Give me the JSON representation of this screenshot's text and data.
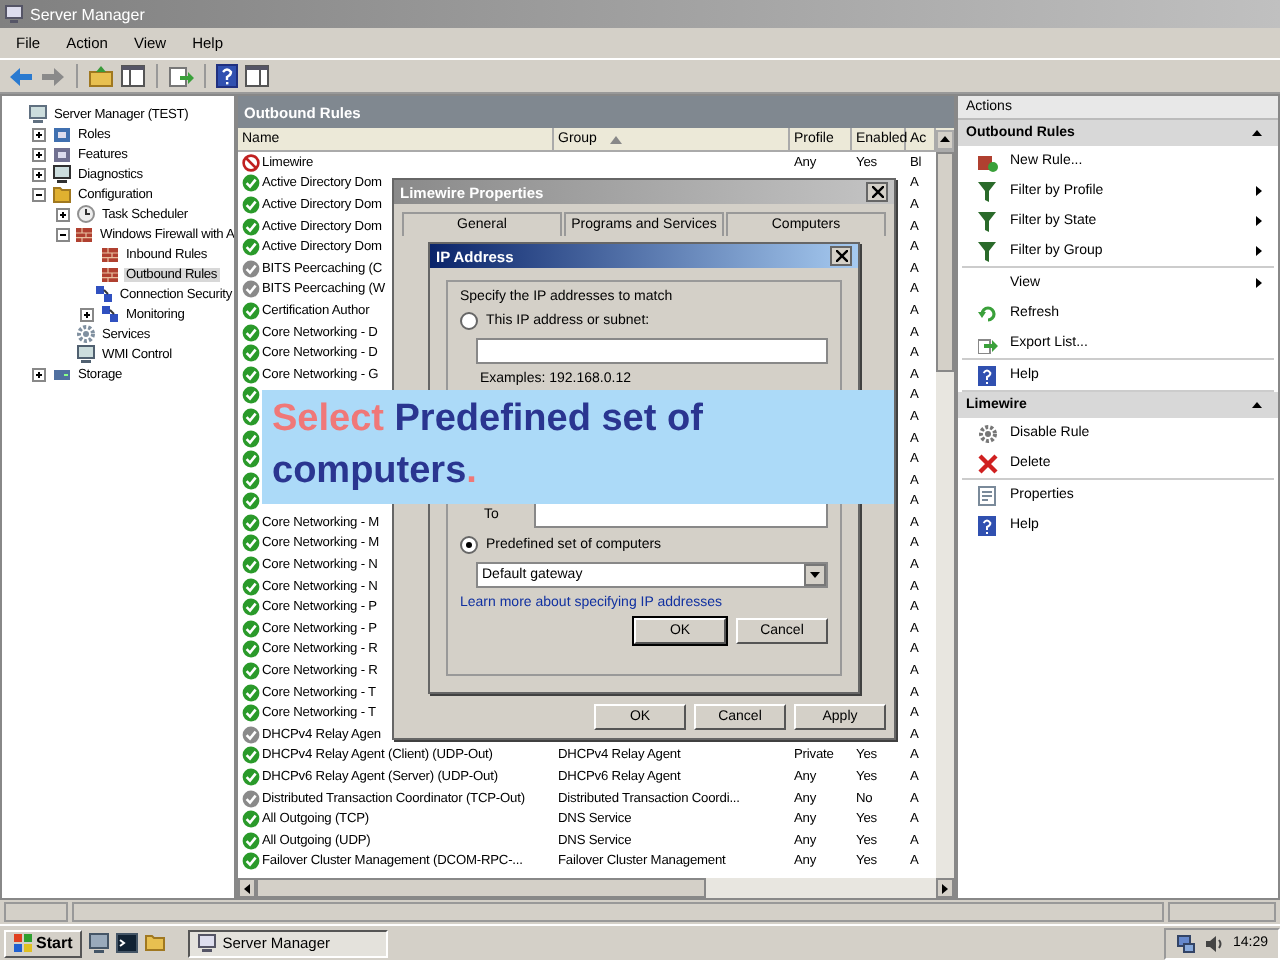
{
  "window": {
    "title": "Server Manager"
  },
  "menu": [
    "File",
    "Action",
    "View",
    "Help"
  ],
  "tree": [
    {
      "label": "Server Manager (TEST)",
      "kind": "server",
      "selected": false,
      "children": [
        {
          "label": "Roles",
          "kind": "roles",
          "selected": false,
          "expanded": false
        },
        {
          "label": "Features",
          "kind": "features",
          "selected": false,
          "expanded": false
        },
        {
          "label": "Diagnostics",
          "kind": "diagnostics",
          "selected": false,
          "expanded": false
        },
        {
          "label": "Configuration",
          "kind": "configuration",
          "selected": false,
          "expanded": true,
          "children": [
            {
              "label": "Task Scheduler",
              "kind": "scheduler",
              "selected": false,
              "expanded": false
            },
            {
              "label": "Windows Firewall with A",
              "kind": "firewall",
              "selected": false,
              "expanded": true,
              "children": [
                {
                  "label": "Inbound Rules",
                  "kind": "inbound",
                  "selected": false
                },
                {
                  "label": "Outbound Rules",
                  "kind": "outbound",
                  "selected": true
                },
                {
                  "label": "Connection Security",
                  "kind": "security",
                  "selected": false
                },
                {
                  "label": "Monitoring",
                  "kind": "monitoring",
                  "selected": false,
                  "expanded": false
                }
              ]
            },
            {
              "label": "Services",
              "kind": "services",
              "selected": false
            },
            {
              "label": "WMI Control",
              "kind": "wmi",
              "selected": false
            }
          ]
        },
        {
          "label": "Storage",
          "kind": "storage",
          "selected": false,
          "expanded": false
        }
      ]
    }
  ],
  "rules": {
    "title": "Outbound Rules",
    "columns": [
      "Name",
      "Group",
      "Profile",
      "Enabled",
      "Ac"
    ],
    "rows": [
      {
        "kind": "block",
        "name": "Limewire",
        "profile": "Any",
        "enabled": "Yes",
        "action": "Bl"
      },
      {
        "kind": "allow",
        "name": "Active Directory Dom",
        "action": "A"
      },
      {
        "kind": "allow",
        "name": "Active Directory Dom",
        "action": "A"
      },
      {
        "kind": "allow",
        "name": "Active Directory Dom",
        "action": "A"
      },
      {
        "kind": "allow",
        "name": "Active Directory Dom",
        "action": "A"
      },
      {
        "kind": "off",
        "name": "BITS Peercaching (C",
        "action": "A"
      },
      {
        "kind": "off",
        "name": "BITS Peercaching (W",
        "action": "A"
      },
      {
        "kind": "allow",
        "name": "Certification Author",
        "action": "A"
      },
      {
        "kind": "allow",
        "name": "Core Networking - D",
        "action": "A"
      },
      {
        "kind": "allow",
        "name": "Core Networking - D",
        "action": "A"
      },
      {
        "kind": "allow",
        "name": "Core Networking - G",
        "action": "A"
      },
      {
        "kind": "allow",
        "action": "A"
      },
      {
        "kind": "allow",
        "action": "A"
      },
      {
        "kind": "allow",
        "action": "A"
      },
      {
        "kind": "allow",
        "action": "A"
      },
      {
        "kind": "allow",
        "action": "A"
      },
      {
        "kind": "allow",
        "action": "A"
      },
      {
        "kind": "allow",
        "name": "Core Networking - M",
        "action": "A"
      },
      {
        "kind": "allow",
        "name": "Core Networking - M",
        "action": "A"
      },
      {
        "kind": "allow",
        "name": "Core Networking - N",
        "action": "A"
      },
      {
        "kind": "allow",
        "name": "Core Networking - N",
        "action": "A"
      },
      {
        "kind": "allow",
        "name": "Core Networking - P",
        "action": "A"
      },
      {
        "kind": "allow",
        "name": "Core Networking - P",
        "action": "A"
      },
      {
        "kind": "allow",
        "name": "Core Networking - R",
        "action": "A"
      },
      {
        "kind": "allow",
        "name": "Core Networking - R",
        "action": "A"
      },
      {
        "kind": "allow",
        "name": "Core Networking - T",
        "action": "A"
      },
      {
        "kind": "allow",
        "name": "Core Networking - T",
        "action": "A"
      },
      {
        "kind": "off",
        "name": "DHCPv4 Relay Agen",
        "action": "A"
      },
      {
        "kind": "allow",
        "name": "DHCPv4 Relay Agent (Client) (UDP-Out)",
        "group": "DHCPv4 Relay Agent",
        "profile": "Private",
        "enabled": "Yes",
        "action": "A"
      },
      {
        "kind": "allow",
        "name": "DHCPv6 Relay Agent (Server) (UDP-Out)",
        "group": "DHCPv6 Relay Agent",
        "profile": "Any",
        "enabled": "Yes",
        "action": "A"
      },
      {
        "kind": "off",
        "name": "Distributed Transaction Coordinator (TCP-Out)",
        "group": "Distributed Transaction Coordi...",
        "profile": "Any",
        "enabled": "No",
        "action": "A"
      },
      {
        "kind": "allow",
        "name": "All Outgoing (TCP)",
        "group": "DNS Service",
        "profile": "Any",
        "enabled": "Yes",
        "action": "A"
      },
      {
        "kind": "allow",
        "name": "All Outgoing (UDP)",
        "group": "DNS Service",
        "profile": "Any",
        "enabled": "Yes",
        "action": "A"
      },
      {
        "kind": "allow",
        "name": "Failover Cluster Management (DCOM-RPC-...",
        "group": "Failover Cluster Management",
        "profile": "Any",
        "enabled": "Yes",
        "action": "A"
      }
    ]
  },
  "properties_dialog": {
    "title": "Limewire Properties",
    "tabs": [
      "General",
      "Programs and Services",
      "Computers"
    ],
    "buttons": [
      "OK",
      "Cancel",
      "Apply"
    ]
  },
  "ip_dialog": {
    "title": "IP Address",
    "prompt": "Specify the IP addresses to match",
    "options": [
      {
        "label": "This IP address or subnet:",
        "selected": false
      },
      {
        "label": "Predefined set of computers",
        "selected": true
      }
    ],
    "example": "Examples: 192.168.0.12",
    "to_label": "To",
    "dropdown": {
      "value": "Default gateway"
    },
    "link": "Learn more about specifying IP addresses",
    "buttons": [
      {
        "label": "OK",
        "default": true
      },
      {
        "label": "Cancel",
        "default": false
      }
    ]
  },
  "actions": {
    "title": "Actions",
    "sections": [
      {
        "title": "Outbound Rules",
        "groups": [
          [
            {
              "label": "New Rule...",
              "kind": "new",
              "submenu": false
            },
            {
              "label": "Filter by Profile",
              "kind": "filter",
              "submenu": true
            },
            {
              "label": "Filter by State",
              "kind": "filter",
              "submenu": true
            },
            {
              "label": "Filter by Group",
              "kind": "filter",
              "submenu": true
            }
          ],
          [
            {
              "label": "View",
              "kind": "plain",
              "submenu": true
            },
            {
              "label": "Refresh",
              "kind": "refresh",
              "submenu": false
            },
            {
              "label": "Export List...",
              "kind": "export",
              "submenu": false
            }
          ],
          [
            {
              "label": "Help",
              "kind": "help",
              "submenu": false
            }
          ]
        ]
      },
      {
        "title": "Limewire",
        "groups": [
          [
            {
              "label": "Disable Rule",
              "kind": "disable",
              "submenu": false
            },
            {
              "label": "Delete",
              "kind": "delete",
              "submenu": false
            }
          ],
          [
            {
              "label": "Properties",
              "kind": "properties",
              "submenu": false
            },
            {
              "label": "Help",
              "kind": "help",
              "submenu": false
            }
          ]
        ]
      }
    ]
  },
  "caption": [
    {
      "text": "Select",
      "accent": true
    },
    {
      "text": " Predefined set of computers",
      "accent": false
    },
    {
      "text": ".",
      "accent": true
    }
  ],
  "taskbar": {
    "start": "Start",
    "tasks": [
      "Server Manager"
    ],
    "clock": "14:29"
  }
}
